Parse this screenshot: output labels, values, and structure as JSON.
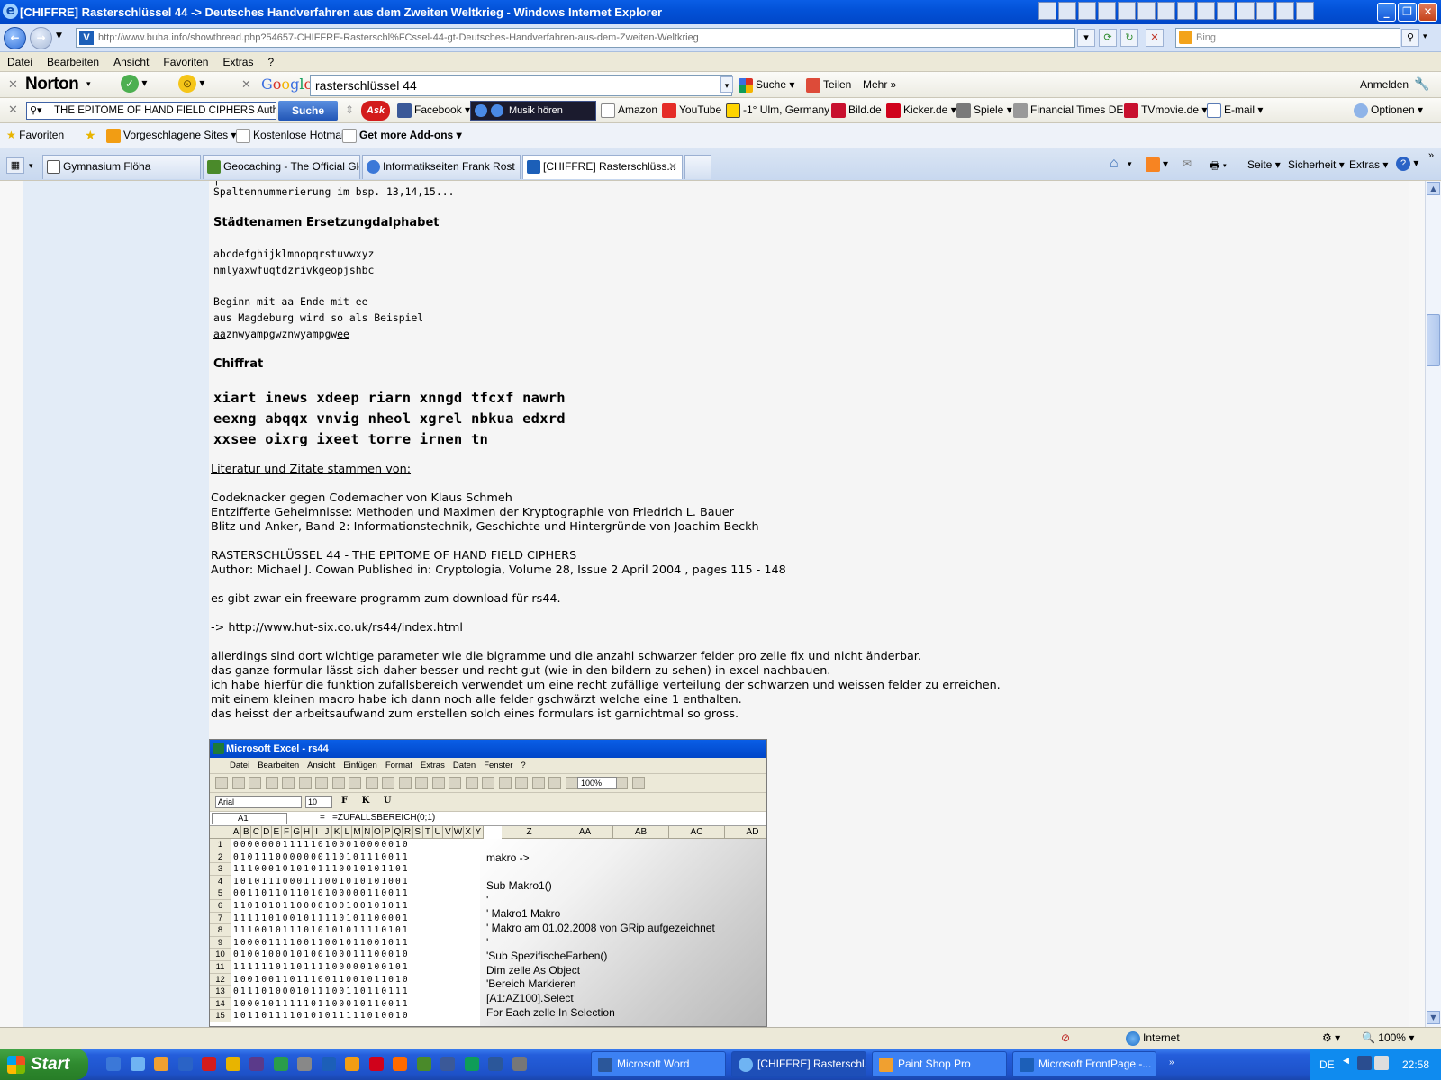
{
  "window": {
    "title": "[CHIFFRE] Rasterschlüssel 44 -> Deutsches Handverfahren aus dem Zweiten Weltkrieg - Windows Internet Explorer"
  },
  "address": {
    "url": "http://www.buha.info/showthread.php?54657-CHIFFRE-Rasterschl%FCssel-44-gt-Deutsches-Handverfahren-aus-dem-Zweiten-Weltkrieg",
    "search_placeholder": "Bing"
  },
  "menu": [
    "Datei",
    "Bearbeiten",
    "Ansicht",
    "Favoriten",
    "Extras",
    "?"
  ],
  "toolbar_norton": {
    "brand": "Norton",
    "google_query": "rasterschlüssel 44",
    "suche": "Suche",
    "teilen": "Teilen",
    "mehr": "Mehr",
    "anmelden": "Anmelden"
  },
  "toolbar_ask": {
    "query": "THE EPITOME OF HAND FIELD CIPHERS  Auth",
    "search_button": "Suche",
    "ask": "Ask",
    "facebook": "Facebook",
    "music": "Musik hören",
    "amazon": "Amazon",
    "youtube": "YouTube",
    "weather": "-1° Ulm, Germany",
    "bild": "Bild.de",
    "kicker": "Kicker.de",
    "spiele": "Spiele",
    "ft": "Financial Times DE",
    "tvmovie": "TVmovie.de",
    "email": "E-mail",
    "optionen": "Optionen"
  },
  "favorites_bar": {
    "favoriten": "Favoriten",
    "vorgeschlagene": "Vorgeschlagene Sites",
    "hotmail": "Kostenlose Hotmail",
    "addons": "Get more Add-ons"
  },
  "tabs": [
    {
      "label": "Gymnasium Flöha"
    },
    {
      "label": "Geocaching - The Official Glo..."
    },
    {
      "label": "Informatikseiten Frank Rost"
    },
    {
      "label": "[CHIFFRE] Rasterschlüss..."
    }
  ],
  "command_bar": {
    "seite": "Seite",
    "sicherheit": "Sicherheit",
    "extras": "Extras"
  },
  "post": {
    "line_top": "Spaltennummerierung im bsp. 13,14,15...",
    "heading1": "Städtenamen Ersetzungdalphabet",
    "alpha1": "abcdefghijklmnopqrstuvwxyz",
    "alpha2": "nmlyaxwfuqtdzrivkgeopjshbc",
    "begin1": "Beginn mit aa Ende mit ee",
    "begin2": "aus Magdeburg wird so als Beispiel",
    "encoded_pre": "aa",
    "encoded_mid": "znwyampgwznwyampgw",
    "encoded_post": "ee",
    "heading2": "Chiffrat",
    "cipher": [
      "xiart inews xdeep riarn xnngd tfcxf nawrh",
      "eexng abqqx vnvig nheol xgrel nbkua edxrd",
      "xxsee oixrg ixeet torre irnen tn"
    ],
    "lit_heading": "Literatur und Zitate stammen von:",
    "lit": [
      "Codeknacker gegen Codemacher von Klaus Schmeh",
      "Entzifferte Geheimnisse: Methoden und Maximen der Kryptographie von Friedrich L. Bauer",
      "Blitz und Anker, Band 2: Informationstechnik, Geschichte und Hintergründe von Joachim Beckh"
    ],
    "ref1": "RASTERSCHLÜSSEL 44 - THE EPITOME OF HAND FIELD CIPHERS",
    "ref2": "Author: Michael J. Cowan Published in: Cryptologia, Volume 28, Issue 2 April 2004 , pages 115 - 148",
    "freeware": "es gibt zwar ein freeware programm zum download für rs44.",
    "link_prefix": "-> ",
    "link": "http://www.hut-six.co.uk/rs44/index.html",
    "para": [
      "allerdings sind dort wichtige parameter wie die bigramme und die anzahl schwarzer felder pro zeile fix und nicht änderbar.",
      "das ganze formular lässt sich daher besser und recht gut (wie in den bildern zu sehen) in excel nachbauen.",
      "ich habe hierfür die funktion zufallsbereich verwendet um eine recht zufällige verteilung der schwarzen und weissen felder zu erreichen.",
      "mit einem kleinen macro habe ich dann noch alle felder gschwärzt welche eine 1 enthalten.",
      "das heisst der arbeitsaufwand zum erstellen solch eines formulars ist garnichtmal so gross."
    ]
  },
  "excel": {
    "title": "Microsoft Excel - rs44",
    "menu": [
      "Datei",
      "Bearbeiten",
      "Ansicht",
      "Einfügen",
      "Format",
      "Extras",
      "Daten",
      "Fenster",
      "?"
    ],
    "font": "Arial",
    "size": "10",
    "zoom": "100%",
    "namebox": "A1",
    "formula": "=ZUFALLSBEREICH(0;1)",
    "cols": [
      "A",
      "B",
      "C",
      "D",
      "E",
      "F",
      "G",
      "H",
      "I",
      "J",
      "K",
      "L",
      "M",
      "N",
      "O",
      "P",
      "Q",
      "R",
      "S",
      "T",
      "U",
      "V",
      "W",
      "X",
      "Y"
    ],
    "wide_cols": [
      "Z",
      "AA",
      "AB",
      "AC",
      "AD"
    ],
    "rows": [
      "0000000111110100010000010",
      "0101110000000110101110011",
      "1110001010101110010101101",
      "1010111000111001010101001",
      "0011011011010100000110011",
      "1101010110000100100101011",
      "1111101001011110101100001",
      "1110010111010101011110101",
      "1000011110011001011001011",
      "0100100010100100011100010",
      "1111110110111100000100101",
      "1001001101110011001011010",
      "0111010001011100110110111",
      "1000101111101100010110011",
      "1011011110101011111010010"
    ],
    "macro": [
      "makro ->",
      "",
      "Sub Makro1()",
      "'",
      "' Makro1 Makro",
      "' Makro am 01.02.2008 von GRip aufgezeichnet",
      "'",
      "'Sub SpezifischeFarben()",
      "Dim zelle As Object",
      "'Bereich Markieren",
      "[A1:AZ100].Select",
      "For Each zelle In Selection"
    ]
  },
  "status": {
    "zone": "Internet",
    "zoom": "100%"
  },
  "taskbar": {
    "start": "Start",
    "buttons": [
      {
        "label": "Microsoft Word"
      },
      {
        "label": "[CHIFFRE] Rasterschl..."
      },
      {
        "label": "Paint Shop Pro"
      },
      {
        "label": "Microsoft FrontPage -..."
      }
    ],
    "lang": "DE",
    "clock": "22:58"
  }
}
